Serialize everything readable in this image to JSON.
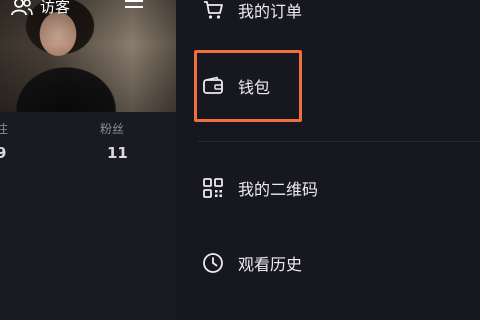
{
  "profile": {
    "visitor_label": "访客",
    "stats": [
      {
        "label": "注",
        "value": "9"
      },
      {
        "label": "粉丝",
        "value": "11"
      }
    ]
  },
  "drawer": {
    "items": [
      {
        "label": "我的订单",
        "icon": "cart-icon"
      },
      {
        "label": "钱包",
        "icon": "wallet-icon"
      },
      {
        "label": "我的二维码",
        "icon": "qr-code-icon"
      },
      {
        "label": "观看历史",
        "icon": "clock-icon"
      }
    ]
  },
  "colors": {
    "highlight": "#f0703c",
    "background": "#17171f"
  }
}
